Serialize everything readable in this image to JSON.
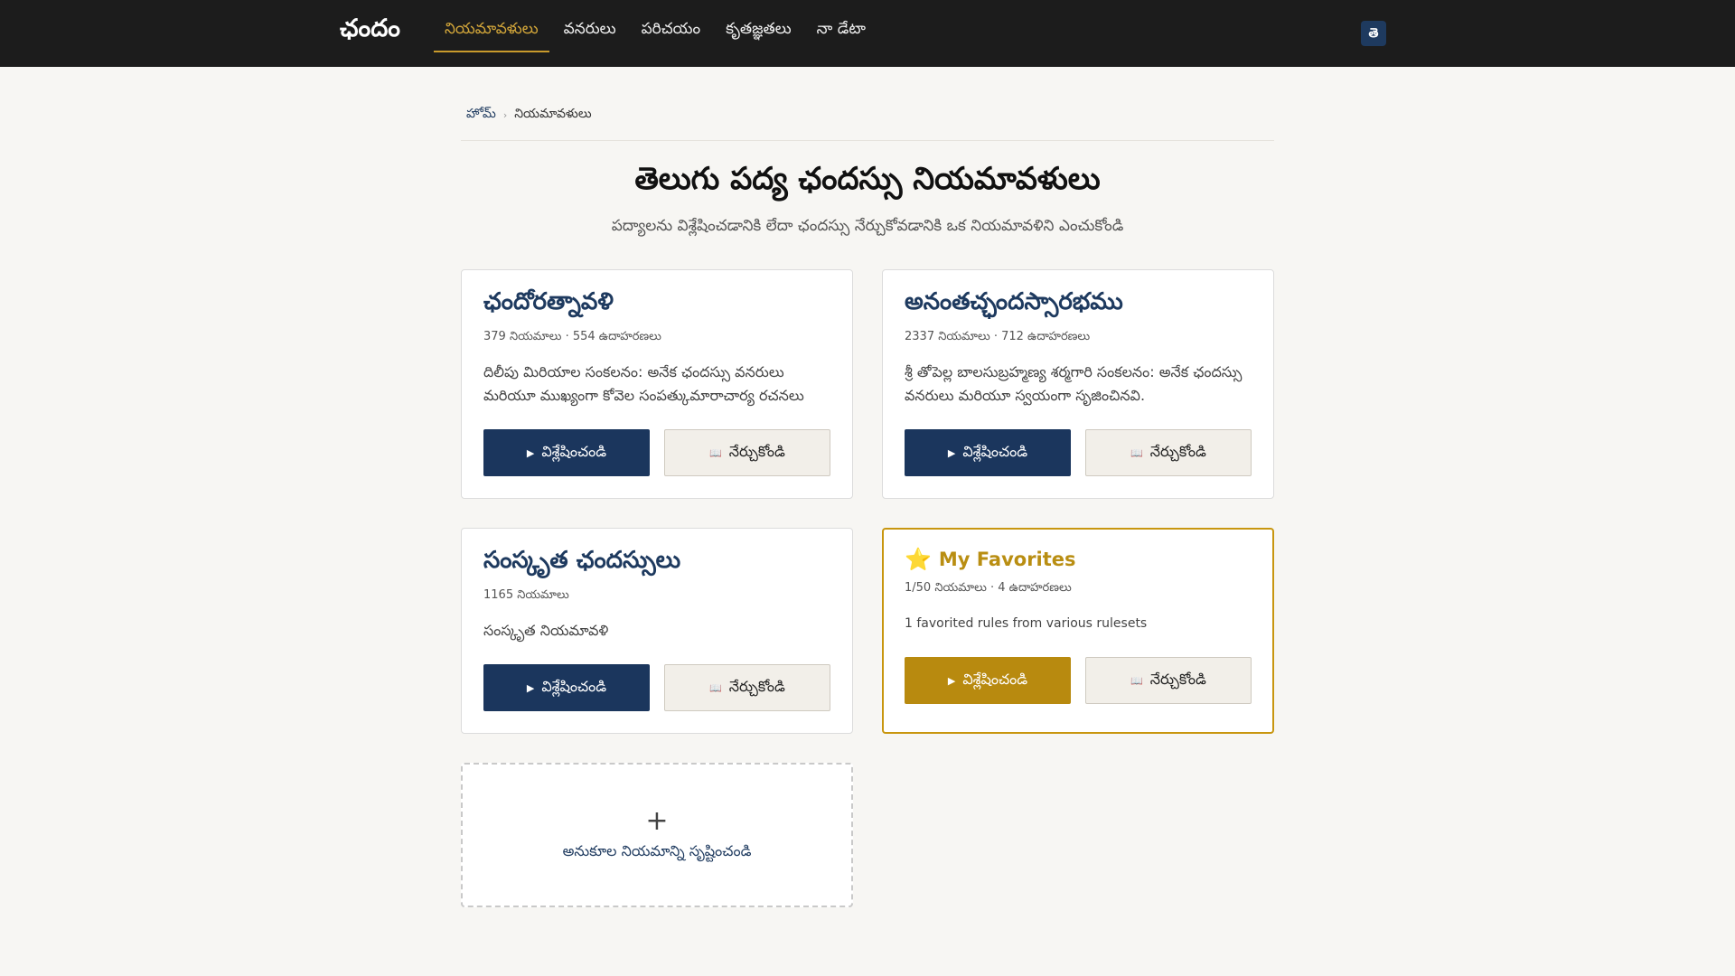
{
  "header": {
    "brand": "ఛందం",
    "nav": [
      {
        "label": "నియమావళులు",
        "active": true
      },
      {
        "label": "వనరులు"
      },
      {
        "label": "పరిచయం"
      },
      {
        "label": "కృతజ్ఞతలు"
      },
      {
        "label": "నా డేటా"
      }
    ],
    "lang_label": "తె"
  },
  "breadcrumb": {
    "home": "హోమ్",
    "separator": "›",
    "current": "నియమావళులు"
  },
  "page": {
    "title": "తెలుగు పద్య ఛందస్సు నియమావళులు",
    "subtitle": "పద్యాలను విశ్లేషించడానికి లేదా ఛందస్సు నేర్చుకోవడానికి ఒక నియమావళిని ఎంచుకోండి"
  },
  "cards": [
    {
      "title": "ఛందోరత్నావళి",
      "meta": "379 నియమాలు · 554 ఉదాహరణలు",
      "desc": "దిలీపు మిరియాల సంకలనం: అనేక ఛందస్సు వనరులు మరియూ ముఖ్యంగా కోవెల సంపత్కుమారాచార్య రచనలు",
      "analyze": "విశ్లేషించండి",
      "learn": "నేర్చుకోండి"
    },
    {
      "title": "అనంతచ్ఛందస్సారభము",
      "meta": "2337 నియమాలు · 712 ఉదాహరణలు",
      "desc": "శ్రీ తోపెల్ల బాలసుబ్రహ్మణ్య శర్మగారి సంకలనం: అనేక ఛందస్సు వనరులు మరియూ స్వయంగా సృజించినవి.",
      "analyze": "విశ్లేషించండి",
      "learn": "నేర్చుకోండి"
    },
    {
      "title": "సంస్కృత ఛందస్సులు",
      "meta": "1165 నియమాలు",
      "desc": "సంస్కృత నియమావళి",
      "analyze": "విశ్లేషించండి",
      "learn": "నేర్చుకోండి"
    },
    {
      "title": "My Favorites",
      "meta": "1/50 నియమాలు · 4 ఉదాహరణలు",
      "desc": "1 favorited rules from various rulesets",
      "analyze": "విశ్లేషించండి",
      "learn": "నేర్చుకోండి"
    }
  ],
  "add_card": {
    "plus": "+",
    "label": "అనుకూల నియమాన్ని సృష్టించండి"
  },
  "icons": {
    "star": "⭐",
    "play": "▶",
    "book": "📖"
  },
  "colors": {
    "nav_bg": "#1c1c1c",
    "accent_gold": "#c89a2c",
    "primary_navy": "#1b365d"
  }
}
